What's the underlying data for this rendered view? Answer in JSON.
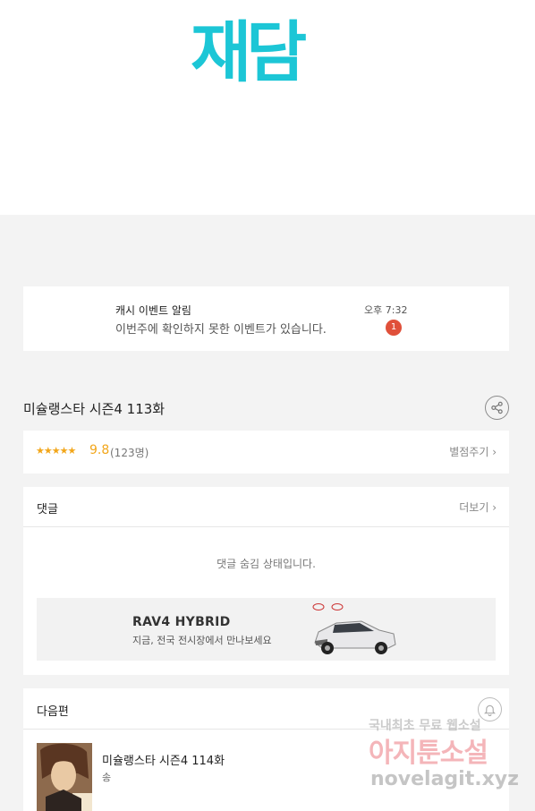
{
  "logo": "재담",
  "notice": {
    "title": "캐시 이벤트 알림",
    "body": "이번주에 확인하지 못한 이벤트가 있습니다.",
    "time": "오후 7:32",
    "badge": "1"
  },
  "episode": {
    "title": "미슐랭스타 시즌4 113화"
  },
  "rating": {
    "stars": "★★★★★",
    "score": "9.8",
    "count": "(123명)",
    "rate_button": "별점주기 ›"
  },
  "comments": {
    "title": "댓글",
    "more": "더보기 ›",
    "hidden_message": "댓글 숨김 상태입니다."
  },
  "ad": {
    "title": "RAV4 HYBRID",
    "subtitle": "지금, 전국 전시장에서 만나보세요"
  },
  "next": {
    "title": "다음편",
    "episode_title": "미슐랭스타 시즌4 114화",
    "episode_sub": "송"
  },
  "watermark": {
    "line1": "국내최초 무료 웹소설",
    "line2": "아지툰소설",
    "line3": "novelagit.xyz"
  }
}
